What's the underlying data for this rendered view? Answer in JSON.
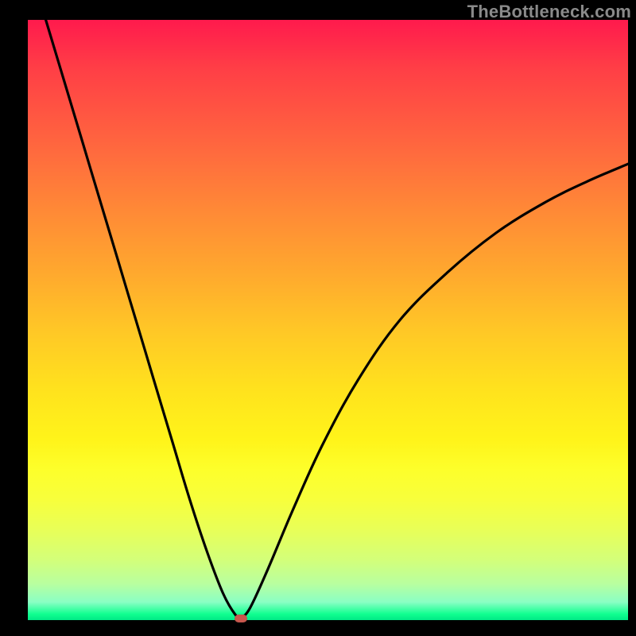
{
  "watermark": "TheBottleneck.com",
  "colors": {
    "page_bg": "#000000",
    "gradient_top": "#ff1a4d",
    "gradient_mid": "#ffe31d",
    "gradient_bottom": "#00e886",
    "curve": "#000000",
    "marker": "#c9584e",
    "watermark_text": "#8a8a8a"
  },
  "chart_data": {
    "type": "line",
    "title": "",
    "xlabel": "",
    "ylabel": "",
    "xlim": [
      0,
      1
    ],
    "ylim": [
      0,
      1
    ],
    "series": [
      {
        "name": "bottleneck-curve",
        "x": [
          0.03,
          0.06,
          0.09,
          0.12,
          0.15,
          0.18,
          0.21,
          0.24,
          0.27,
          0.3,
          0.325,
          0.345,
          0.355,
          0.37,
          0.4,
          0.44,
          0.49,
          0.55,
          0.62,
          0.7,
          0.78,
          0.86,
          0.93,
          1.0
        ],
        "y": [
          1.0,
          0.9,
          0.8,
          0.7,
          0.6,
          0.5,
          0.4,
          0.3,
          0.2,
          0.11,
          0.045,
          0.01,
          0.005,
          0.02,
          0.085,
          0.18,
          0.29,
          0.4,
          0.5,
          0.58,
          0.645,
          0.695,
          0.73,
          0.76
        ]
      }
    ],
    "annotations": [
      {
        "name": "optimum-marker",
        "x": 0.355,
        "y": 0.003
      }
    ]
  }
}
